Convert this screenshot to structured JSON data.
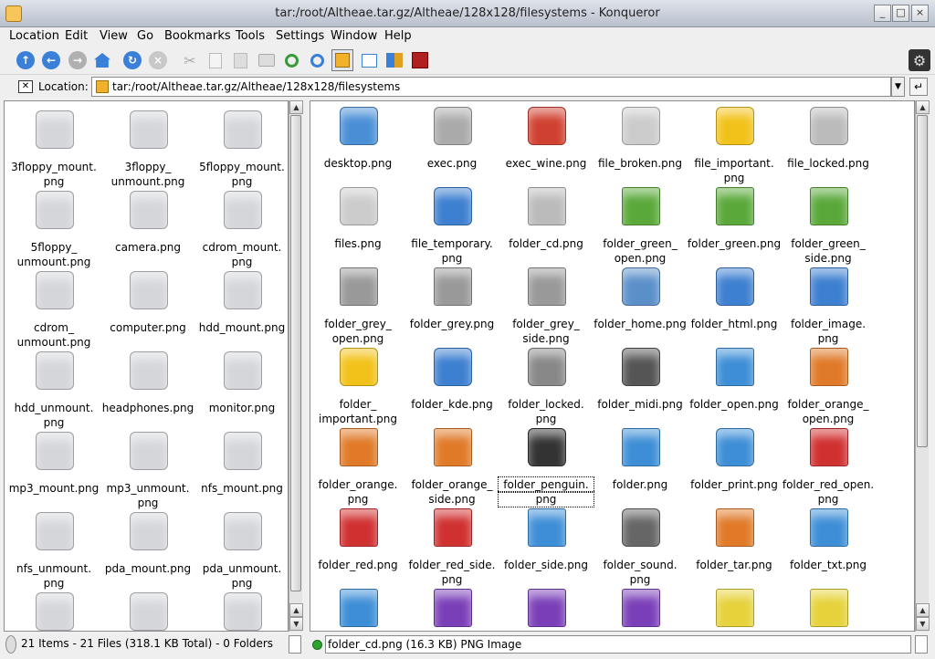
{
  "window": {
    "title": "tar:/root/Altheae.tar.gz/Altheae/128x128/filesystems - Konqueror",
    "min": "_",
    "max": "□",
    "close": "×"
  },
  "menu": [
    "Location",
    "Edit",
    "View",
    "Go",
    "Bookmarks",
    "Tools",
    "Settings",
    "Window",
    "Help"
  ],
  "location": {
    "label": "Location:",
    "value": "tar:/root/Altheae.tar.gz/Altheae/128x128/filesystems"
  },
  "left_items": [
    {
      "l1": "3floppy_mount.",
      "l2": "png",
      "icon": "floppy-icon"
    },
    {
      "l1": "3floppy_",
      "l2": "unmount.png",
      "icon": "floppy-icon"
    },
    {
      "l1": "5floppy_mount.",
      "l2": "png",
      "icon": "floppy-icon"
    },
    {
      "l1": "5floppy_",
      "l2": "unmount.png",
      "icon": "floppy-icon"
    },
    {
      "l1": "camera.png",
      "l2": "",
      "icon": "camera-icon"
    },
    {
      "l1": "cdrom_mount.",
      "l2": "png",
      "icon": "cdrom-icon"
    },
    {
      "l1": "cdrom_",
      "l2": "unmount.png",
      "icon": "cdrom-icon"
    },
    {
      "l1": "computer.png",
      "l2": "",
      "icon": "computer-icon"
    },
    {
      "l1": "hdd_mount.png",
      "l2": "",
      "icon": "hdd-icon"
    },
    {
      "l1": "hdd_unmount.",
      "l2": "png",
      "icon": "hdd-icon"
    },
    {
      "l1": "headphones.png",
      "l2": "",
      "icon": "headphones-icon"
    },
    {
      "l1": "monitor.png",
      "l2": "",
      "icon": "monitor-icon"
    },
    {
      "l1": "mp3_mount.png",
      "l2": "",
      "icon": "mp3-icon"
    },
    {
      "l1": "mp3_unmount.",
      "l2": "png",
      "icon": "mp3-icon"
    },
    {
      "l1": "nfs_mount.png",
      "l2": "",
      "icon": "nfs-icon"
    },
    {
      "l1": "nfs_unmount.",
      "l2": "png",
      "icon": "nfs-icon"
    },
    {
      "l1": "pda_mount.png",
      "l2": "",
      "icon": "pda-icon"
    },
    {
      "l1": "pda_unmount.",
      "l2": "png",
      "icon": "pda-icon"
    },
    {
      "l1": "",
      "l2": "",
      "icon": "printer-icon"
    },
    {
      "l1": "",
      "l2": "",
      "icon": "speaker-icon"
    },
    {
      "l1": "",
      "l2": "",
      "icon": "antenna-icon"
    }
  ],
  "right_items": [
    {
      "l1": "desktop.png",
      "l2": "",
      "icon": "kde-desktop-icon",
      "c": "#4a8fd6"
    },
    {
      "l1": "exec.png",
      "l2": "",
      "icon": "gear-icon",
      "c": "#aaaaaa"
    },
    {
      "l1": "exec_wine.png",
      "l2": "",
      "icon": "wine-icon",
      "c": "#d04030"
    },
    {
      "l1": "file_broken.png",
      "l2": "",
      "icon": "file-broken-icon",
      "c": "#cccccc"
    },
    {
      "l1": "file_important.",
      "l2": "png",
      "icon": "warning-icon",
      "c": "#f2c21a"
    },
    {
      "l1": "file_locked.png",
      "l2": "",
      "icon": "lock-icon",
      "c": "#bbbbbb"
    },
    {
      "l1": "files.png",
      "l2": "",
      "icon": "files-icon",
      "c": "#cccccc"
    },
    {
      "l1": "file_temporary.",
      "l2": "png",
      "icon": "clock-icon",
      "c": "#3d7fd0"
    },
    {
      "l1": "folder_cd.png",
      "l2": "",
      "icon": "folder-cd-icon",
      "c": "#bbbbbb"
    },
    {
      "l1": "folder_green_",
      "l2": "open.png",
      "icon": "folder-green-icon",
      "c": "#5aa83a"
    },
    {
      "l1": "folder_green.png",
      "l2": "",
      "icon": "folder-green-icon",
      "c": "#5aa83a"
    },
    {
      "l1": "folder_green_",
      "l2": "side.png",
      "icon": "folder-green-icon",
      "c": "#5aa83a"
    },
    {
      "l1": "folder_grey_",
      "l2": "open.png",
      "icon": "folder-grey-icon",
      "c": "#999999"
    },
    {
      "l1": "folder_grey.png",
      "l2": "",
      "icon": "folder-grey-icon",
      "c": "#999999"
    },
    {
      "l1": "folder_grey_",
      "l2": "side.png",
      "icon": "folder-grey-icon",
      "c": "#999999"
    },
    {
      "l1": "folder_home.png",
      "l2": "",
      "icon": "house-icon",
      "c": "#5b8fc9"
    },
    {
      "l1": "folder_html.png",
      "l2": "",
      "icon": "globe-icon",
      "c": "#3d7fd0"
    },
    {
      "l1": "folder_image.",
      "l2": "png",
      "icon": "folder-image-icon",
      "c": "#3d7fd0"
    },
    {
      "l1": "folder_",
      "l2": "important.png",
      "icon": "warning-icon",
      "c": "#f2c21a"
    },
    {
      "l1": "folder_kde.png",
      "l2": "",
      "icon": "kde-icon",
      "c": "#3d7fd0"
    },
    {
      "l1": "folder_locked.",
      "l2": "png",
      "icon": "lock-icon",
      "c": "#888888"
    },
    {
      "l1": "folder_midi.png",
      "l2": "",
      "icon": "piano-icon",
      "c": "#555555"
    },
    {
      "l1": "folder_open.png",
      "l2": "",
      "icon": "folder-blue-icon",
      "c": "#3d8ed6"
    },
    {
      "l1": "folder_orange_",
      "l2": "open.png",
      "icon": "folder-orange-icon",
      "c": "#e07a28"
    },
    {
      "l1": "folder_orange.",
      "l2": "png",
      "icon": "folder-orange-icon",
      "c": "#e07a28"
    },
    {
      "l1": "folder_orange_",
      "l2": "side.png",
      "icon": "folder-orange-icon",
      "c": "#e07a28"
    },
    {
      "l1": "folder_penguin.",
      "l2": "png",
      "icon": "penguin-icon",
      "c": "#333333",
      "sel": true
    },
    {
      "l1": "folder.png",
      "l2": "",
      "icon": "folder-blue-icon",
      "c": "#3d8ed6"
    },
    {
      "l1": "folder_print.png",
      "l2": "",
      "icon": "printer-icon",
      "c": "#3d8ed6"
    },
    {
      "l1": "folder_red_open.",
      "l2": "png",
      "icon": "folder-red-icon",
      "c": "#d03030"
    },
    {
      "l1": "folder_red.png",
      "l2": "",
      "icon": "folder-red-icon",
      "c": "#d03030"
    },
    {
      "l1": "folder_red_side.",
      "l2": "png",
      "icon": "folder-red-icon",
      "c": "#d03030"
    },
    {
      "l1": "folder_side.png",
      "l2": "",
      "icon": "folder-blue-icon",
      "c": "#3d8ed6"
    },
    {
      "l1": "folder_sound.",
      "l2": "png",
      "icon": "speaker-icon",
      "c": "#666666"
    },
    {
      "l1": "folder_tar.png",
      "l2": "",
      "icon": "folder-tar-icon",
      "c": "#e07a28"
    },
    {
      "l1": "folder_txt.png",
      "l2": "",
      "icon": "folder-txt-icon",
      "c": "#3d8ed6"
    },
    {
      "l1": "",
      "l2": "",
      "icon": "folder-video-icon",
      "c": "#3d8ed6"
    },
    {
      "l1": "",
      "l2": "",
      "icon": "folder-violet-icon",
      "c": "#7a3fb8"
    },
    {
      "l1": "",
      "l2": "",
      "icon": "folder-violet-icon",
      "c": "#7a3fb8"
    },
    {
      "l1": "",
      "l2": "",
      "icon": "folder-violet-icon",
      "c": "#7a3fb8"
    },
    {
      "l1": "",
      "l2": "",
      "icon": "folder-yellow-icon",
      "c": "#e6d23a"
    },
    {
      "l1": "",
      "l2": "",
      "icon": "folder-yellow-icon",
      "c": "#e6d23a"
    }
  ],
  "status": {
    "left": "21 Items - 21 Files (318.1 KB Total) - 0 Folders",
    "right": "folder_cd.png (16.3 KB)  PNG Image"
  }
}
